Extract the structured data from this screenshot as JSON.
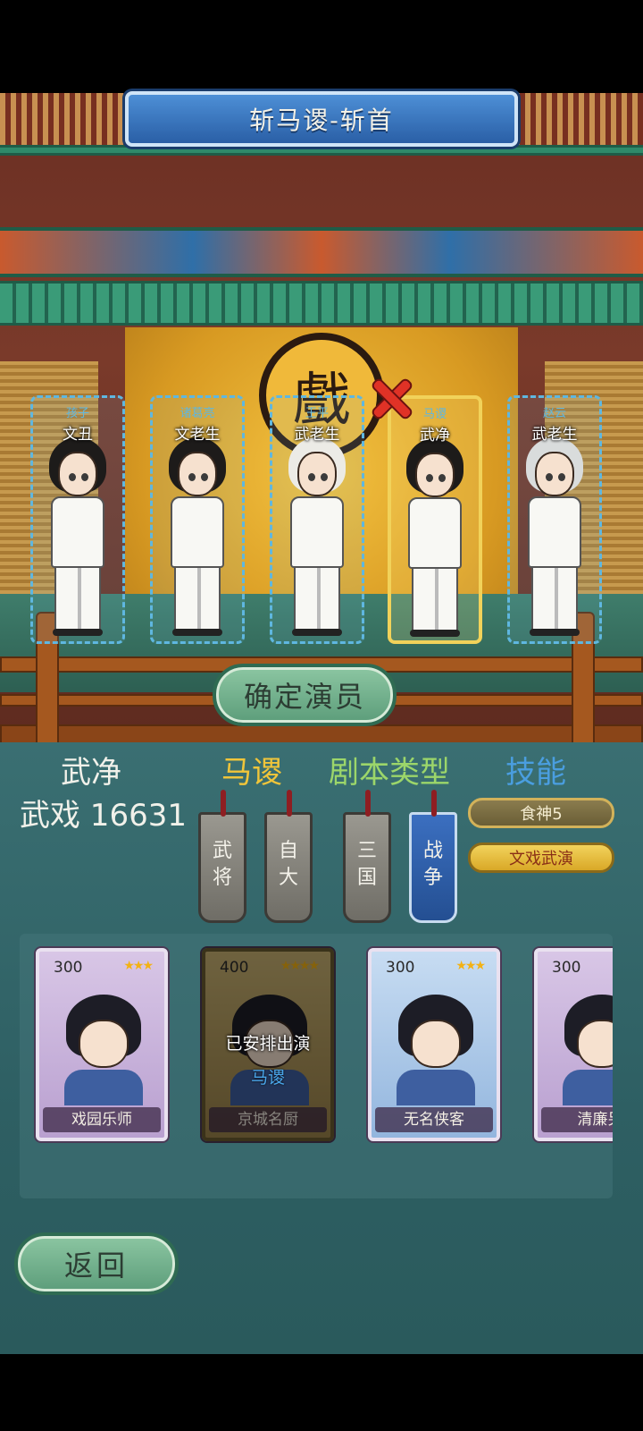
{
  "stage": {
    "title": "斩马谡-斩首",
    "emblem_char": "戲",
    "confirm_label": "确定演员"
  },
  "slots": [
    {
      "sub": "孩子",
      "role": "文丑",
      "hair_color": "#1d1b1a",
      "selected": false
    },
    {
      "sub": "诸葛亮",
      "role": "文老生",
      "hair_color": "#1d1b1a",
      "selected": false
    },
    {
      "sub": "王平",
      "role": "武老生",
      "hair_color": "#ecebe6",
      "selected": false
    },
    {
      "sub": "马谡",
      "role": "武净",
      "hair_color": "#1d1b1a",
      "selected": true
    },
    {
      "sub": "赵云",
      "role": "武老生",
      "hair_color": "#d9dcdc",
      "selected": false
    }
  ],
  "panel": {
    "actor_name": "武净",
    "actor_score": "武戏 16631",
    "headers": {
      "role": "马谡",
      "script": "剧本类型",
      "skill": "技能"
    },
    "tags": [
      {
        "text": "武将",
        "style": "gray"
      },
      {
        "text": "自大",
        "style": "gray"
      },
      {
        "text": "三国",
        "style": "gray"
      },
      {
        "text": "战争",
        "style": "blue"
      }
    ],
    "skills": [
      {
        "text": "食神5",
        "style": "normal"
      },
      {
        "text": "文戏武演",
        "style": "gold"
      }
    ],
    "cards": [
      {
        "cost": "300",
        "stars": "★★★",
        "name": "戏园乐师",
        "style": "purple"
      },
      {
        "cost": "400",
        "stars": "★★★★",
        "name": "京城名厨",
        "style": "gold"
      },
      {
        "cost": "300",
        "stars": "★★★",
        "name": "无名侠客",
        "style": "blue"
      },
      {
        "cost": "300",
        "stars": "",
        "name": "清廉另",
        "style": "purple"
      }
    ],
    "card_overlay": {
      "text": "已安排出演",
      "role": "马谡"
    },
    "back_label": "返回"
  },
  "colors": {
    "slot_border": "#5fb7e0",
    "selected_border": "#f1d25a",
    "header_role": "#f0c53a",
    "header_script": "#9cd66a",
    "header_skill": "#4a9ee0"
  }
}
